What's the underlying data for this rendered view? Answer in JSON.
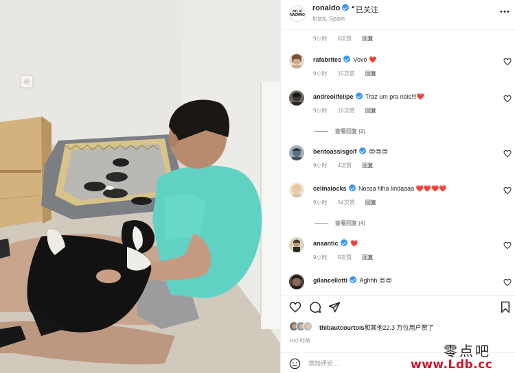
{
  "post": {
    "username": "ronaldo",
    "separator": "•",
    "follow_status": "已关注",
    "location": "Ibiza, Spain",
    "avatar_text": "NO 10 NAZÁRIO"
  },
  "top_meta": {
    "time": "9小时",
    "likes": "8次赞",
    "reply": "回复"
  },
  "comments": [
    {
      "user": "rafabrites",
      "verified": true,
      "text": "Vovó ❤️",
      "time": "9小时",
      "likes": "15次赞",
      "reply": "回复",
      "avatar_color": "#c9a98d"
    },
    {
      "user": "andreolifelipe",
      "verified": true,
      "text": "Traz um pra nois!!!❤️",
      "time": "9小时",
      "likes": "16次赞",
      "reply": "回复",
      "avatar_color": "#3d3a36",
      "view_replies": "查看回复 (2)"
    },
    {
      "user": "bentoassisgolf",
      "verified": true,
      "text": "😍😍😍",
      "time": "9小时",
      "likes": "4次赞",
      "reply": "回复",
      "avatar_color": "#5d7280"
    },
    {
      "user": "celinalocks",
      "verified": true,
      "text": "Nossa filha lindaaaa ❤️❤️❤️❤️",
      "time": "9小时",
      "likes": "64次赞",
      "reply": "回复",
      "avatar_color": "#d8c7ae",
      "view_replies": "查看回复 (4)"
    },
    {
      "user": "anaantic",
      "verified": true,
      "text": "❤️",
      "time": "9小时",
      "likes": "9次赞",
      "reply": "回复",
      "avatar_color": "#8a7a5e"
    },
    {
      "user": "gilancellotti",
      "verified": true,
      "text": "Aghhh 😍😍",
      "time": "",
      "likes": "",
      "reply": "",
      "avatar_color": "#2f2a28"
    }
  ],
  "likes_summary": {
    "user": "thibautcourtois",
    "rest": "和其他22.3 万位用户赞了"
  },
  "time_ago": "10小时前",
  "add_comment": {
    "placeholder": "添加评论..."
  },
  "watermark": {
    "line1": "零点吧",
    "line2": "www.Ldb.cc"
  },
  "colors": {
    "verified": "#3897f0",
    "secondary_text": "#8e8e8e",
    "watermark_red": "#d0142c"
  },
  "icons": {
    "like": "heart-icon",
    "comment": "comment-bubble-icon",
    "share": "paper-plane-icon",
    "save": "bookmark-icon",
    "emoji": "smiley-icon",
    "more": "more-dots-icon"
  }
}
